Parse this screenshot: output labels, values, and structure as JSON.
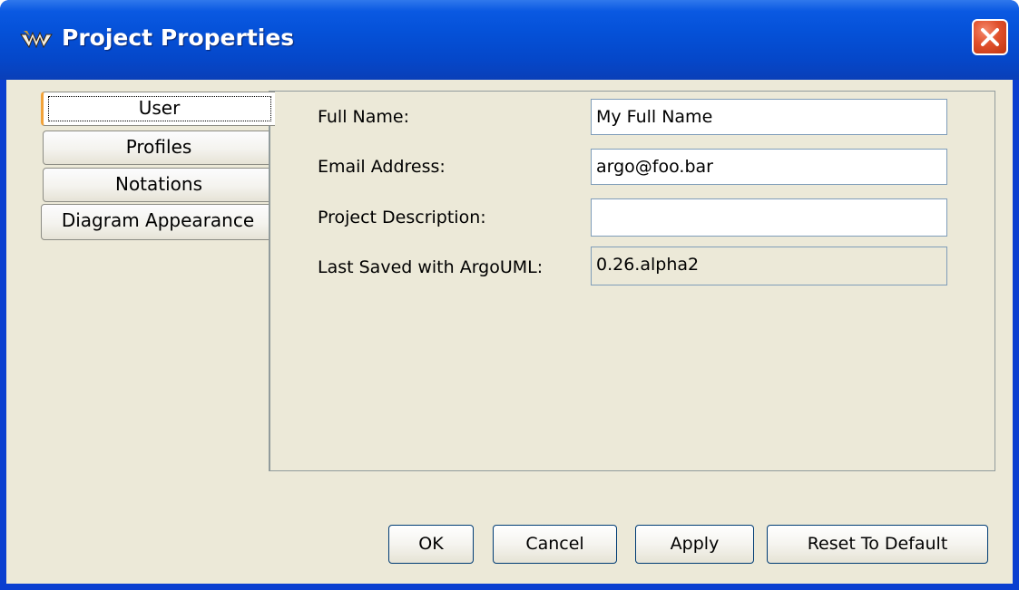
{
  "window": {
    "title": "Project Properties",
    "close_icon": "close-icon",
    "app_icon": "argouml-icon"
  },
  "tabs": [
    {
      "label": "User",
      "selected": true
    },
    {
      "label": "Profiles",
      "selected": false
    },
    {
      "label": "Notations",
      "selected": false
    },
    {
      "label": "Diagram Appearance",
      "selected": false
    }
  ],
  "form": {
    "full_name": {
      "label": "Full Name:",
      "value": "My Full Name"
    },
    "email": {
      "label": "Email Address:",
      "value": "argo@foo.bar"
    },
    "description": {
      "label": "Project Description:",
      "value": ""
    },
    "last_saved": {
      "label": "Last Saved with ArgoUML:",
      "value": "0.26.alpha2"
    }
  },
  "buttons": {
    "ok": "OK",
    "cancel": "Cancel",
    "apply": "Apply",
    "reset": "Reset To Default"
  },
  "colors": {
    "titlebar": "#0551d8",
    "dialog_bg": "#ece9d8",
    "close_button": "#e0502c",
    "selected_tab_accent": "#f2a33a"
  }
}
